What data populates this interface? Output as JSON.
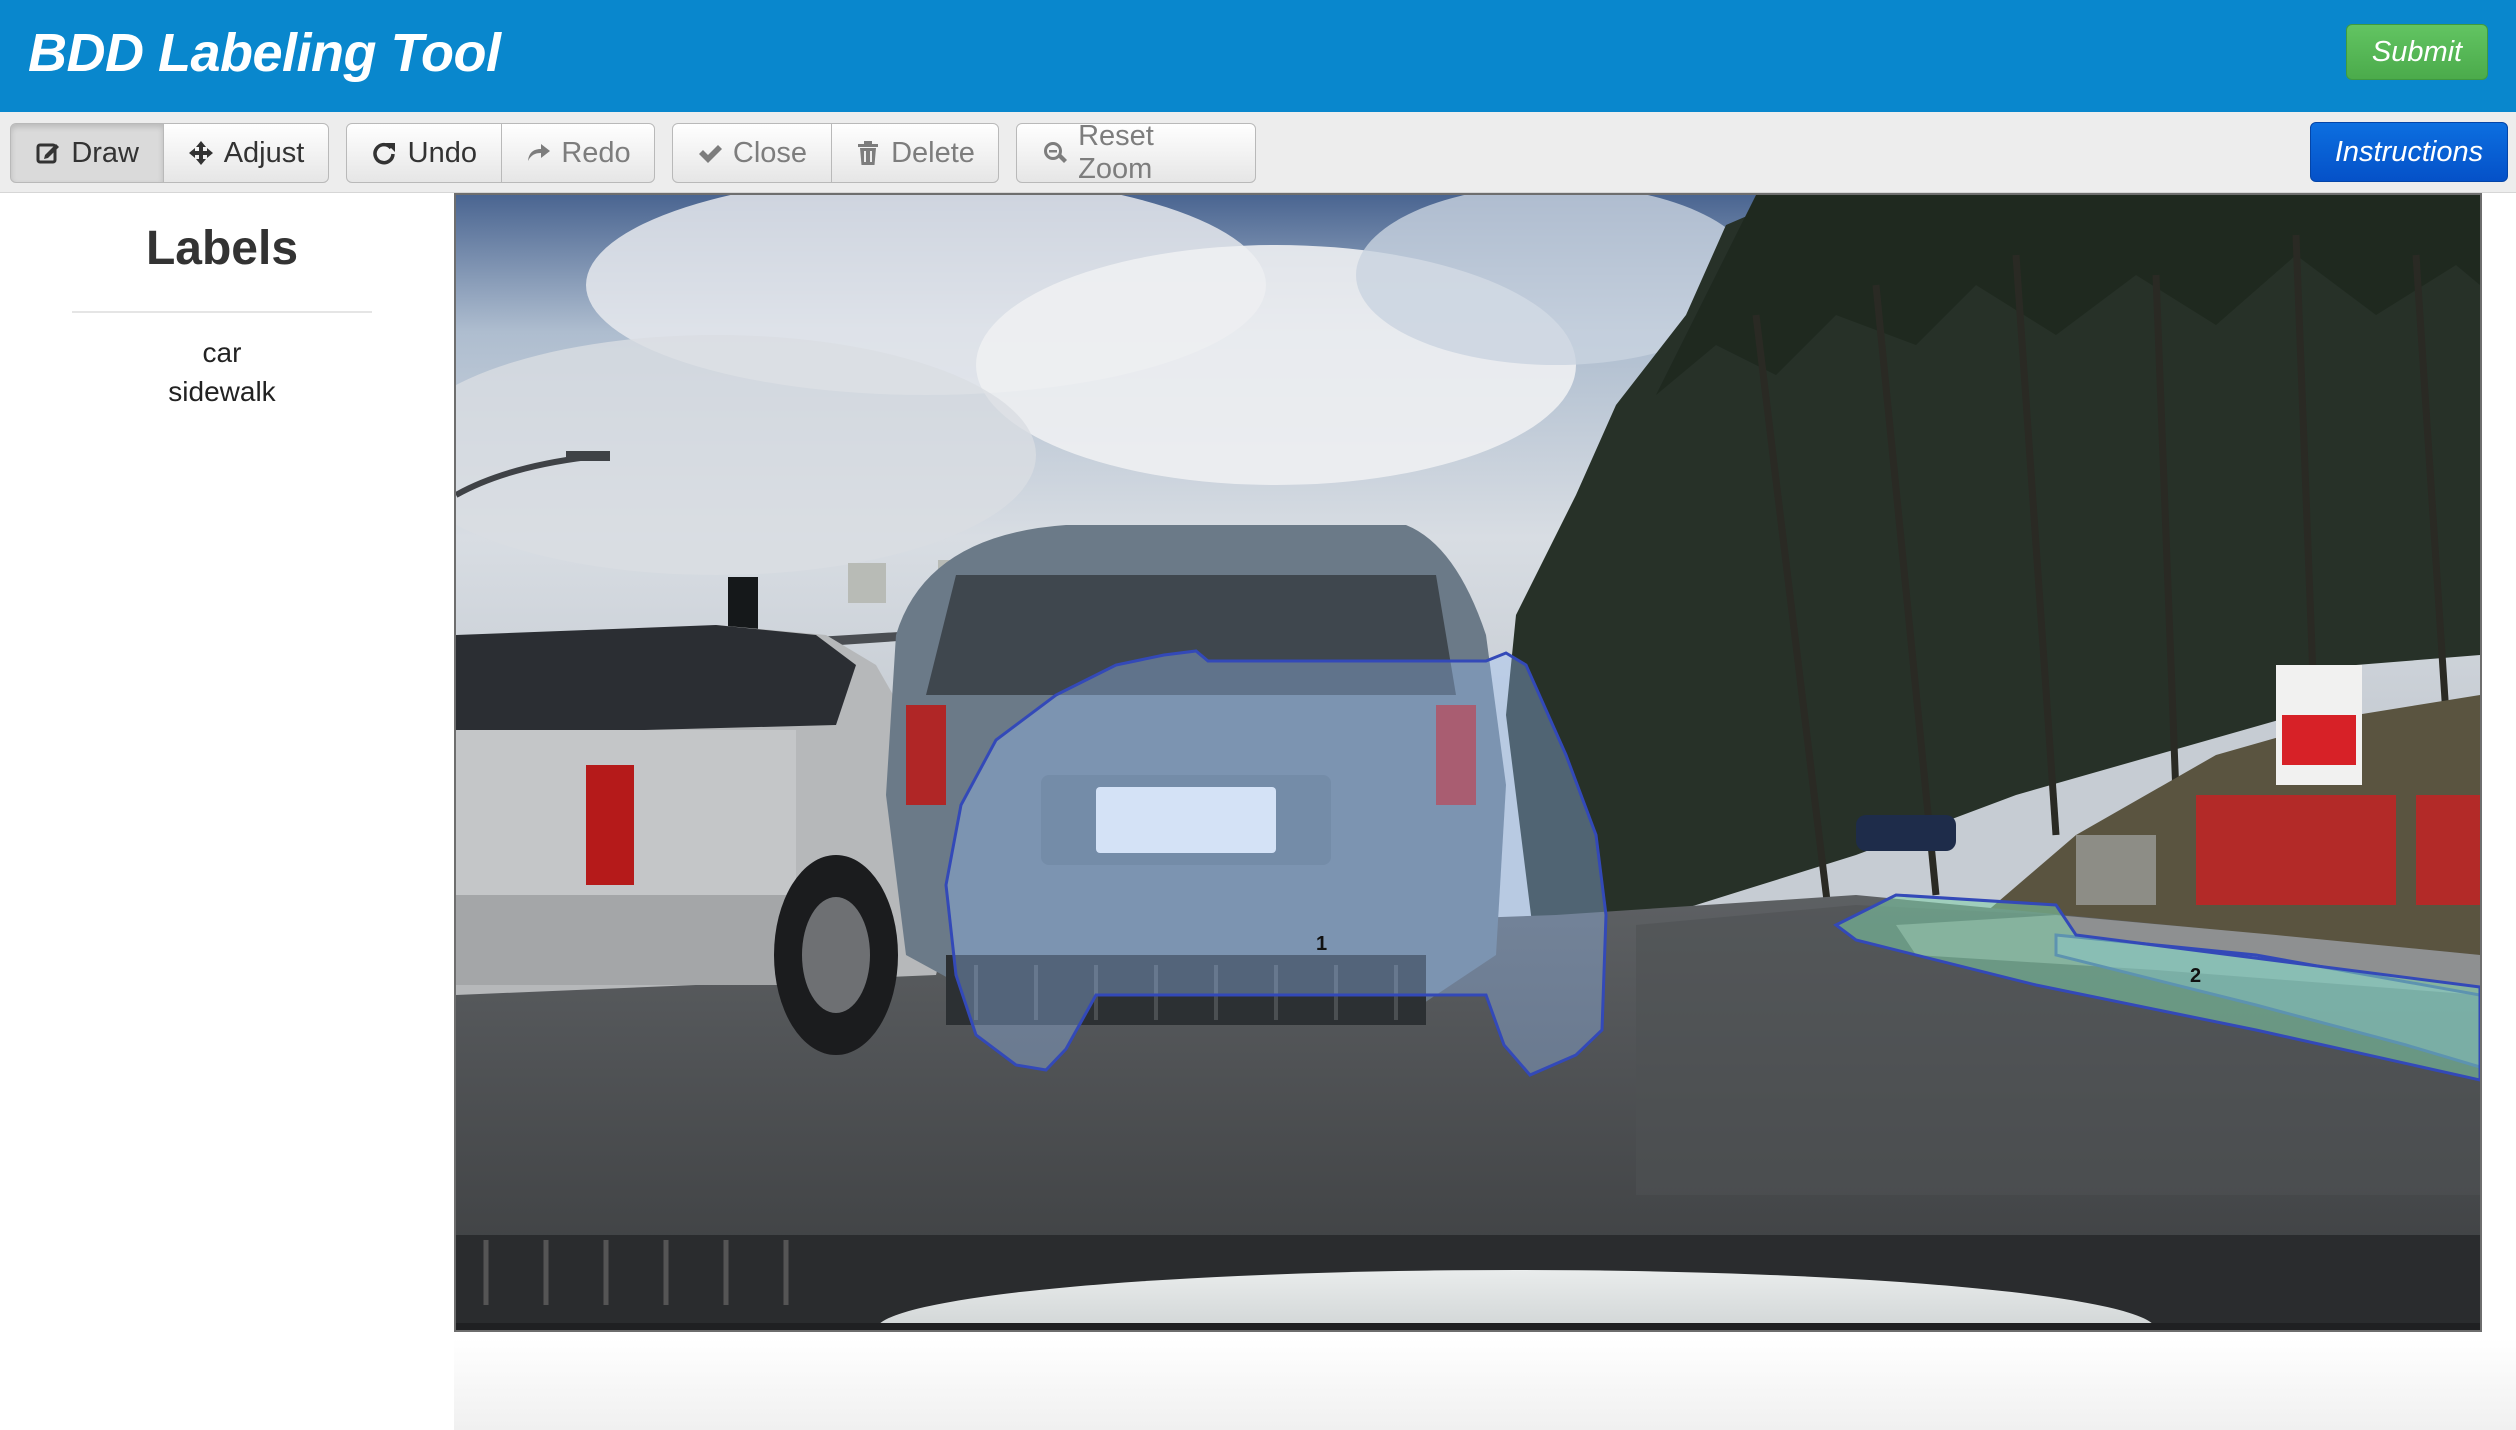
{
  "header": {
    "title": "BDD Labeling Tool",
    "submit_label": "Submit"
  },
  "toolbar": {
    "draw_label": "Draw",
    "adjust_label": "Adjust",
    "undo_label": "Undo",
    "redo_label": "Redo",
    "close_label": "Close",
    "delete_label": "Delete",
    "reset_zoom_label": "Reset Zoom",
    "instructions_label": "Instructions"
  },
  "sidebar": {
    "title": "Labels",
    "labels": [
      "car",
      "sidewalk"
    ]
  },
  "canvas": {
    "annotations": [
      {
        "id": "1",
        "label": "car",
        "color": "#3349b8"
      },
      {
        "id": "2",
        "label": "sidewalk",
        "color": "#3349b8"
      }
    ]
  },
  "colors": {
    "header_bg": "#0987cd",
    "submit_bg": "#5cb85c",
    "instructions_bg": "#0a5fd6",
    "polygon_fill": "#9fc6ff"
  }
}
